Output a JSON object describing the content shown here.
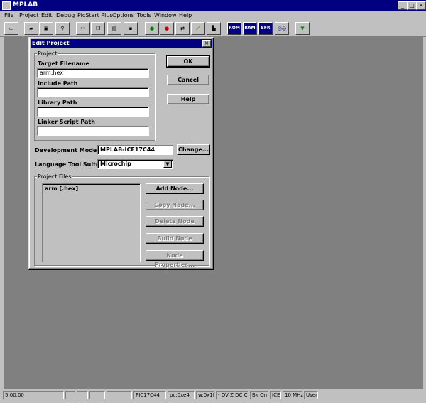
{
  "window": {
    "title": "MPLAB",
    "controls": {
      "minimize": "_",
      "maximize": "□",
      "close": "×"
    }
  },
  "menu": [
    "File",
    "Project",
    "Edit",
    "Debug",
    "PicStart Plus",
    "Options",
    "Tools",
    "Window",
    "Help"
  ],
  "toolbar": {
    "buttons": [
      {
        "icon": "folder-tab-icon"
      },
      {
        "icon": "open-icon"
      },
      {
        "icon": "save-icon"
      },
      {
        "icon": "search-icon"
      },
      {
        "icon": "cut-icon"
      },
      {
        "icon": "copy-icon"
      },
      {
        "icon": "paste-icon"
      },
      {
        "icon": "disk-icon"
      },
      {
        "icon": "run-icon"
      },
      {
        "icon": "halt-icon"
      },
      {
        "icon": "step-icon"
      },
      {
        "icon": "animate-icon"
      },
      {
        "icon": "reset-icon"
      },
      {
        "icon": "rom-icon",
        "label": "ROM"
      },
      {
        "icon": "ram-icon",
        "label": "RAM"
      },
      {
        "icon": "sfr-icon",
        "label": "SFR"
      },
      {
        "icon": "watch-icon"
      },
      {
        "icon": "filter-icon"
      }
    ]
  },
  "dialog": {
    "title": "Edit Project",
    "close": "×",
    "project_group": "Project",
    "target_filename_label": "Target Filename",
    "target_filename_value": "arm.hex",
    "include_path_label": "Include Path",
    "include_path_value": "",
    "library_path_label": "Library Path",
    "library_path_value": "",
    "linker_script_label": "Linker Script Path",
    "linker_script_value": "",
    "ok": "OK",
    "cancel": "Cancel",
    "help": "Help",
    "dev_mode_label": "Development Mode:",
    "dev_mode_value": "MPLAB-ICE17C44",
    "change": "Change...",
    "lang_suite_label": "Language Tool Suite:",
    "lang_suite_value": "Microchip",
    "files_group": "Project Files",
    "files": [
      "arm [.hex]"
    ],
    "add_node": "Add Node...",
    "copy_node": "Copy Node...",
    "delete_node": "Delete Node",
    "build_node": "Build Node",
    "node_properties": "Node Properties..."
  },
  "status": {
    "time": "5:00.00",
    "device": "PIC17C44",
    "pc": "pc:0xe4",
    "w": "w:0x1f",
    "flags": "- OV Z DC C",
    "bk": "Bk On",
    "mode": "ICE",
    "freq": "10 MHz",
    "user": "User"
  }
}
